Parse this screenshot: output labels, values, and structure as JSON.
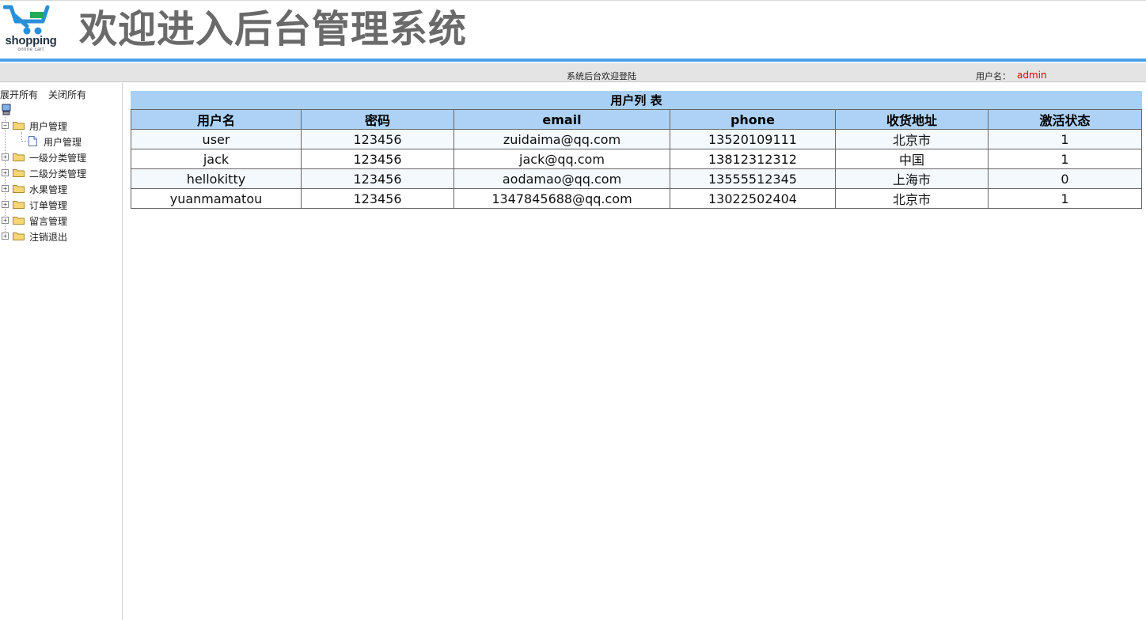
{
  "logo": {
    "text": "shopping",
    "subtext": "online cart",
    "accent": "#2a8fd8"
  },
  "header": {
    "title": "欢迎进入后台管理系统"
  },
  "status_bar": {
    "welcome": "系统后台欢迎登陆",
    "user_label": "用户名：",
    "user_value": "admin"
  },
  "sidebar": {
    "expand_all": "展开所有",
    "collapse_all": "关闭所有",
    "root_icon": "computer-icon",
    "tree": [
      {
        "label": "用户管理",
        "expanded": true,
        "children": [
          {
            "label": "用户管理"
          }
        ]
      },
      {
        "label": "一级分类管理",
        "expanded": false
      },
      {
        "label": "二级分类管理",
        "expanded": false
      },
      {
        "label": "水果管理",
        "expanded": false
      },
      {
        "label": "订单管理",
        "expanded": false
      },
      {
        "label": "留言管理",
        "expanded": false
      },
      {
        "label": "注销退出",
        "expanded": false
      }
    ]
  },
  "table": {
    "caption": "用户列 表",
    "columns": [
      "用户名",
      "密码",
      "email",
      "phone",
      "收货地址",
      "激活状态"
    ],
    "rows": [
      [
        "user",
        "123456",
        "zuidaima@qq.com",
        "13520109111",
        "北京市",
        "1"
      ],
      [
        "jack",
        "123456",
        "jack@qq.com",
        "13812312312",
        "中国",
        "1"
      ],
      [
        "hellokitty",
        "123456",
        "aodamao@qq.com",
        "13555512345",
        "上海市",
        "0"
      ],
      [
        "yuanmamatou",
        "123456",
        "1347845688@qq.com",
        "13022502404",
        "北京市",
        "1"
      ]
    ]
  },
  "colors": {
    "header_bar": "#4aa0e6",
    "table_header": "#add2f5",
    "username_highlight": "#e00000"
  }
}
